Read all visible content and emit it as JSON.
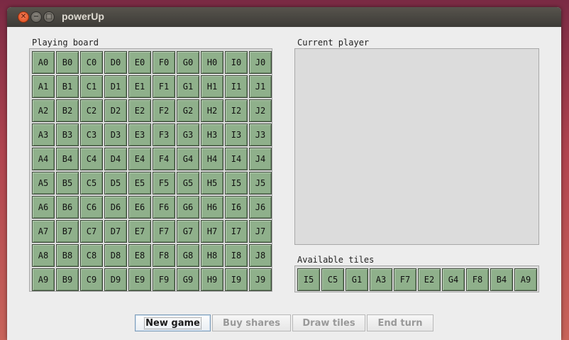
{
  "window": {
    "title": "powerUp"
  },
  "board": {
    "label": "Playing board",
    "rows": [
      [
        "A0",
        "B0",
        "C0",
        "D0",
        "E0",
        "F0",
        "G0",
        "H0",
        "I0",
        "J0"
      ],
      [
        "A1",
        "B1",
        "C1",
        "D1",
        "E1",
        "F1",
        "G1",
        "H1",
        "I1",
        "J1"
      ],
      [
        "A2",
        "B2",
        "C2",
        "D2",
        "E2",
        "F2",
        "G2",
        "H2",
        "I2",
        "J2"
      ],
      [
        "A3",
        "B3",
        "C3",
        "D3",
        "E3",
        "F3",
        "G3",
        "H3",
        "I3",
        "J3"
      ],
      [
        "A4",
        "B4",
        "C4",
        "D4",
        "E4",
        "F4",
        "G4",
        "H4",
        "I4",
        "J4"
      ],
      [
        "A5",
        "B5",
        "C5",
        "D5",
        "E5",
        "F5",
        "G5",
        "H5",
        "I5",
        "J5"
      ],
      [
        "A6",
        "B6",
        "C6",
        "D6",
        "E6",
        "F6",
        "G6",
        "H6",
        "I6",
        "J6"
      ],
      [
        "A7",
        "B7",
        "C7",
        "D7",
        "E7",
        "F7",
        "G7",
        "H7",
        "I7",
        "J7"
      ],
      [
        "A8",
        "B8",
        "C8",
        "D8",
        "E8",
        "F8",
        "G8",
        "H8",
        "I8",
        "J8"
      ],
      [
        "A9",
        "B9",
        "C9",
        "D9",
        "E9",
        "F9",
        "G9",
        "H9",
        "I9",
        "J9"
      ]
    ]
  },
  "current_player": {
    "label": "Current player"
  },
  "available_tiles": {
    "label": "Available tiles",
    "tiles": [
      "I5",
      "C5",
      "G1",
      "A3",
      "F7",
      "E2",
      "G4",
      "F8",
      "B4",
      "A9"
    ]
  },
  "buttons": {
    "new_game": "New game",
    "buy_shares": "Buy shares",
    "draw_tiles": "Draw tiles",
    "end_turn": "End turn"
  },
  "colors": {
    "tile_fill": "#8fb08b",
    "panel_bg": "#dcdcdc",
    "window_bg": "#ededed"
  }
}
